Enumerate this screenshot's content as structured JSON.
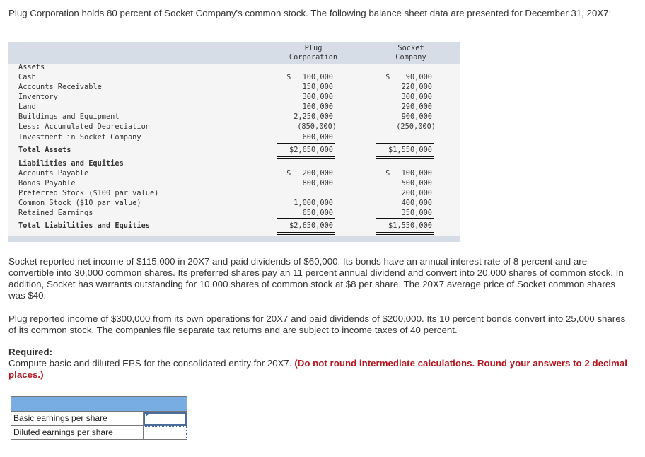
{
  "intro": "Plug Corporation holds 80 percent of Socket Company's common stock. The following balance sheet data are presented for December 31, 20X7:",
  "balance_sheet": {
    "columns": [
      "Plug Corporation",
      "Socket Company"
    ],
    "col1_line1": "Plug",
    "col1_line2": "Corporation",
    "col2_line1": "Socket",
    "col2_line2": "Company",
    "assets_heading": "Assets",
    "asset_rows": [
      {
        "label": "Cash",
        "plug": "100,000",
        "socket": "90,000",
        "plug_dollar": "$",
        "socket_dollar": "$"
      },
      {
        "label": "Accounts Receivable",
        "plug": "150,000",
        "socket": "220,000"
      },
      {
        "label": "Inventory",
        "plug": "300,000",
        "socket": "300,000"
      },
      {
        "label": "Land",
        "plug": "100,000",
        "socket": "290,000"
      },
      {
        "label": "Buildings and Equipment",
        "plug": "2,250,000",
        "socket": "900,000"
      },
      {
        "label": "Less: Accumulated Depreciation",
        "plug": "(850,000)",
        "socket": "(250,000)"
      },
      {
        "label": "Investment in Socket Company",
        "plug": "600,000",
        "socket": ""
      }
    ],
    "total_assets": {
      "label": "Total Assets",
      "plug": "$2,650,000",
      "socket": "$1,550,000"
    },
    "liabilities_heading": "Liabilities and Equities",
    "liability_rows": [
      {
        "label": "Accounts Payable",
        "plug": "200,000",
        "socket": "100,000",
        "plug_dollar": "$",
        "socket_dollar": "$"
      },
      {
        "label": "Bonds Payable",
        "plug": "800,000",
        "socket": "500,000"
      },
      {
        "label": "Preferred Stock ($100 par value)",
        "plug": "",
        "socket": "200,000"
      },
      {
        "label": "Common Stock ($10 par value)",
        "plug": "1,000,000",
        "socket": "400,000"
      },
      {
        "label": "Retained Earnings",
        "plug": "650,000",
        "socket": "350,000"
      }
    ],
    "total_liabilities": {
      "label": "Total Liabilities and Equities",
      "plug": "$2,650,000",
      "socket": "$1,550,000"
    }
  },
  "para1": "Socket reported net income of $115,000 in 20X7 and paid dividends of $60,000. Its bonds have an annual interest rate of 8 percent and are convertible into 30,000 common shares. Its preferred shares pay an 11 percent annual dividend and convert into 20,000 shares of common stock. In addition, Socket has warrants outstanding for 10,000 shares of common stock at $8 per share. The 20X7 average price of Socket common shares was $40.",
  "para2": "Plug reported income of $300,000 from its own operations for 20X7 and paid dividends of $200,000. Its 10 percent bonds convert into 25,000 shares of its common stock. The companies file separate tax returns and are subject to income taxes of 40 percent.",
  "required": {
    "label": "Required:",
    "text": "Compute basic and diluted EPS for the consolidated entity for 20X7. ",
    "instruction": "(Do not round intermediate calculations. Round your answers to 2 decimal places.)"
  },
  "answer_table": {
    "rows": [
      {
        "label": "Basic earnings per share",
        "value": ""
      },
      {
        "label": "Diluted earnings per share",
        "value": ""
      }
    ]
  },
  "colors": {
    "header_band": "#d7dde6",
    "answer_header": "#78ade3",
    "instruction_red": "#b0171f"
  }
}
